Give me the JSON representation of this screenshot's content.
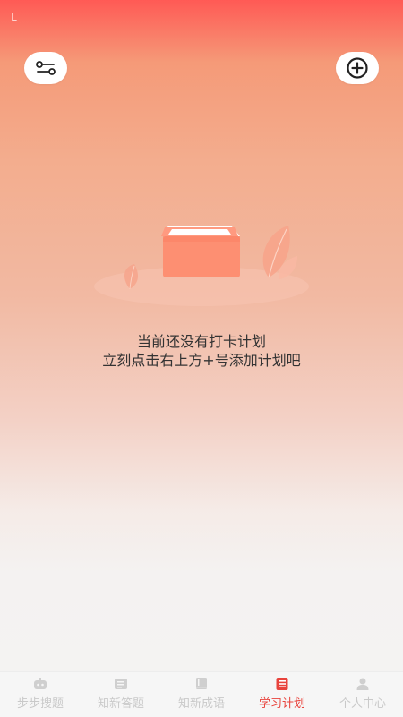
{
  "status": {
    "mark": "L"
  },
  "header": {
    "left_icon": "filter-settings-icon",
    "right_icon": "add-circle-icon"
  },
  "empty_state": {
    "line1": "当前还没有打卡计划",
    "line2": "立刻点击右上方+号添加计划吧",
    "illustration": "empty-box-icon"
  },
  "tabs": [
    {
      "label": "步步搜题",
      "icon": "robot-icon",
      "active": false
    },
    {
      "label": "知新答题",
      "icon": "answer-card-icon",
      "active": false
    },
    {
      "label": "知新成语",
      "icon": "book-icon",
      "active": false
    },
    {
      "label": "学习计划",
      "icon": "plan-list-icon",
      "active": true
    },
    {
      "label": "个人中心",
      "icon": "person-icon",
      "active": false
    }
  ],
  "colors": {
    "accent": "#e8433c",
    "inactive_tab": "#c9c9c9",
    "text": "#333333"
  }
}
